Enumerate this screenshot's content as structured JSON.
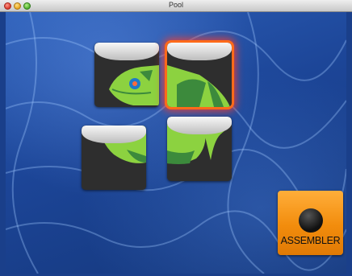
{
  "window": {
    "title": "Pool"
  },
  "tiles": [
    "fish-head",
    "fish-back",
    "fish-belly",
    "fish-tail"
  ],
  "selected_tile": "fish-back",
  "assemble_button": {
    "label": "ASSEMBLER"
  },
  "colors": {
    "fish_light": "#8cd240",
    "fish_dark": "#3c8a3c",
    "eye": "#1e7ac8",
    "selection_glow": "#ff5a1e",
    "button_orange": "#f28c0c"
  }
}
